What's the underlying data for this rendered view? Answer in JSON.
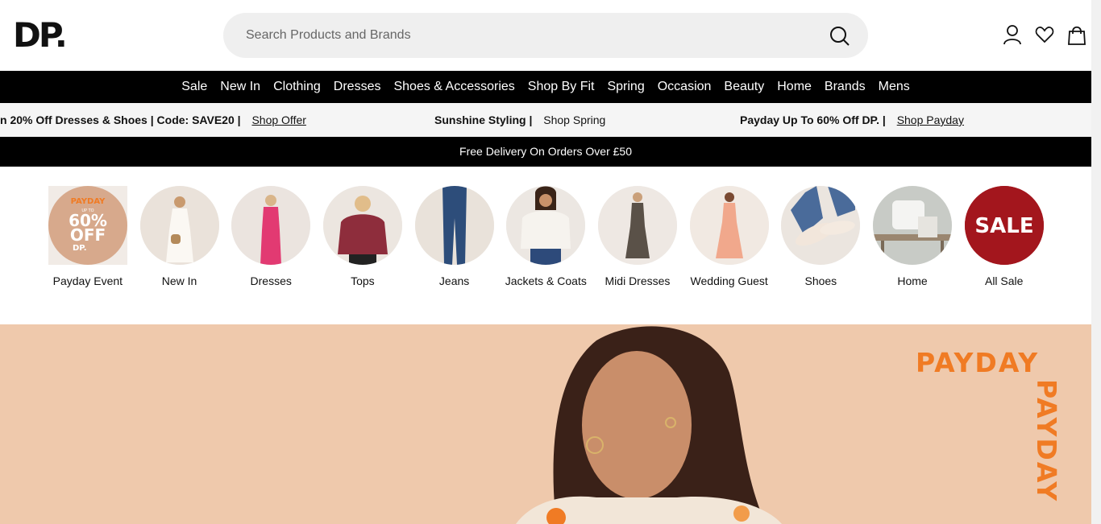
{
  "header": {
    "logo": "DP.",
    "search_placeholder": "Search Products and Brands",
    "icons": [
      "account-icon",
      "wishlist-icon",
      "bag-icon"
    ]
  },
  "nav": {
    "items": [
      "Sale",
      "New In",
      "Clothing",
      "Dresses",
      "Shoes & Accessories",
      "Shop By Fit",
      "Spring",
      "Occasion",
      "Beauty",
      "Home",
      "Brands",
      "Mens"
    ]
  },
  "promos": [
    {
      "text": "n 20% Off Dresses & Shoes | Code: SAVE20 |",
      "link": "Shop Offer"
    },
    {
      "text": "Sunshine Styling |",
      "link": "Shop Spring"
    },
    {
      "text": "Payday Up To 60% Off DP. |",
      "link": "Shop Payday"
    }
  ],
  "delivery": "Free Delivery On Orders Over £50",
  "categories": [
    {
      "label": "Payday Event",
      "badge": "PAYDAY",
      "badge_small": "UP TO",
      "badge_big": "60%",
      "badge_off": "OFF",
      "badge_brand": "DP."
    },
    {
      "label": "New In"
    },
    {
      "label": "Dresses"
    },
    {
      "label": "Tops"
    },
    {
      "label": "Jeans"
    },
    {
      "label": "Jackets & Coats"
    },
    {
      "label": "Midi Dresses"
    },
    {
      "label": "Wedding Guest"
    },
    {
      "label": "Shoes"
    },
    {
      "label": "Home"
    },
    {
      "label": "All Sale",
      "badge": "SALE"
    }
  ],
  "hero": {
    "payday_horizontal": "PAYDAY",
    "payday_vertical": "PAYDAY"
  },
  "colors": {
    "accent_orange": "#f07b24",
    "sale_red": "#a3161d",
    "nav_bg": "#000000",
    "hero_bg": "#efc9ac"
  }
}
